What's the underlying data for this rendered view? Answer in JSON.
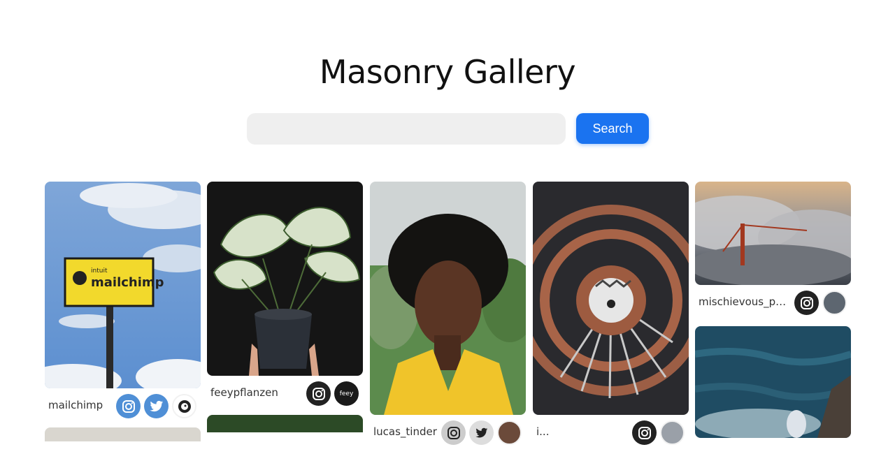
{
  "header": {
    "title": "Masonry Gallery"
  },
  "search": {
    "placeholder": "",
    "value": "",
    "button_label": "Search"
  },
  "cards": [
    {
      "username": "mailchimp",
      "icons": [
        "instagram-icon",
        "twitter-icon",
        "mailchimp-avatar"
      ],
      "accent": "#4f8fd6"
    },
    {
      "username": "feeypflanzen",
      "icons": [
        "instagram-icon",
        "feey-avatar"
      ],
      "avatar_text": "feey"
    },
    {
      "username": "lucas_tinder",
      "icons": [
        "instagram-icon",
        "twitter-icon",
        "avatar"
      ]
    },
    {
      "username": "i...",
      "icons": [
        "instagram-icon",
        "avatar"
      ]
    },
    {
      "username": "mischievous_pe...",
      "icons": [
        "instagram-icon",
        "avatar"
      ]
    }
  ],
  "sign_text": {
    "small": "intuit",
    "big": "mailchimp"
  },
  "colors": {
    "accent": "#1a73f0",
    "input_bg": "#efefef"
  }
}
